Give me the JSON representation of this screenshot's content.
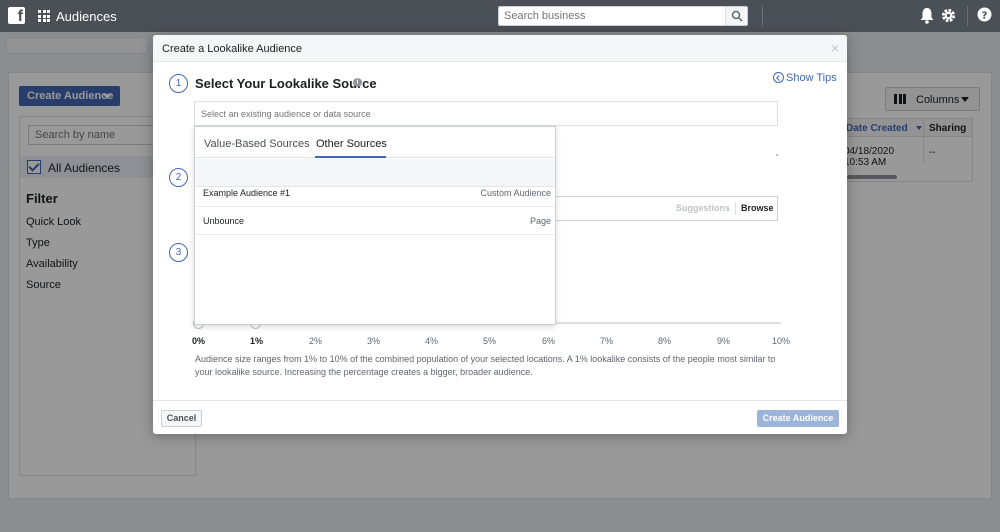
{
  "topbar": {
    "logo_letter": "f",
    "app_title": "Audiences",
    "search_placeholder": "Search business"
  },
  "page": {
    "create_audience_label": "Create Audience",
    "search_placeholder": "Search by name",
    "all_audiences_label": "All Audiences",
    "filter_title": "Filter",
    "filters": [
      "Quick Look",
      "Type",
      "Availability",
      "Source"
    ],
    "columns_label": "Columns",
    "table": {
      "headers": [
        "Date Created",
        "Sharing"
      ],
      "row": {
        "date": "04/18/2020",
        "time": "10:53 AM",
        "sharing": "--"
      }
    }
  },
  "modal": {
    "title": "Create a Lookalike Audience",
    "close_glyph": "×",
    "steps": [
      "1",
      "2",
      "3"
    ],
    "step1_title": "Select Your Lookalike Source",
    "info_glyph": "i",
    "show_tips_label": "Show Tips",
    "source_placeholder": "Select an existing audience or data source",
    "location": {
      "suggestions_label": "Suggestions",
      "browse_label": "Browse"
    },
    "dropdown": {
      "tabs": [
        "Value-Based Sources",
        "Other Sources"
      ],
      "active_tab": "Other Sources",
      "items": [
        {
          "name": "Example Audience #1",
          "type": "Custom Audience"
        },
        {
          "name": "Unbounce",
          "type": "Page"
        }
      ]
    },
    "slider": {
      "ticks": [
        "0%",
        "1%",
        "2%",
        "3%",
        "4%",
        "5%",
        "6%",
        "7%",
        "8%",
        "9%",
        "10%"
      ],
      "selected_range": [
        0,
        1
      ]
    },
    "help_text": "Audience size ranges from 1% to 10% of the combined population of your selected locations. A 1% lookalike consists of the people most similar to your lookalike source. Increasing the percentage creates a bigger, broader audience.",
    "cancel_label": "Cancel",
    "create_label": "Create Audience"
  },
  "colors": {
    "brand": "#4267b2",
    "topbar": "#4b4f56",
    "disabled_button": "#9cb4d8"
  }
}
